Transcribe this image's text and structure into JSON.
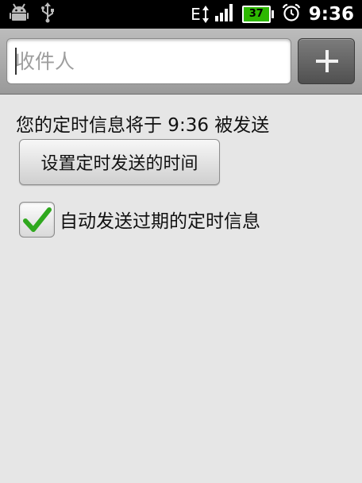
{
  "status_bar": {
    "icons": [
      "android-debug-icon",
      "usb-icon"
    ],
    "network_type": "E",
    "battery_level": "37",
    "alarm_icon": "alarm-clock-icon",
    "time": "9:36"
  },
  "composer": {
    "recipient_placeholder": "收件人",
    "add_recipient_icon": "plus-icon"
  },
  "schedule": {
    "info_text": "您的定时信息将于 9:36 被发送",
    "set_time_button_label": "设置定时发送的时间",
    "auto_send_expired_label": "自动发送过期的定时信息",
    "auto_send_expired_checked": true
  },
  "colors": {
    "check_green": "#2fa81e",
    "battery_green": "#2db800"
  }
}
